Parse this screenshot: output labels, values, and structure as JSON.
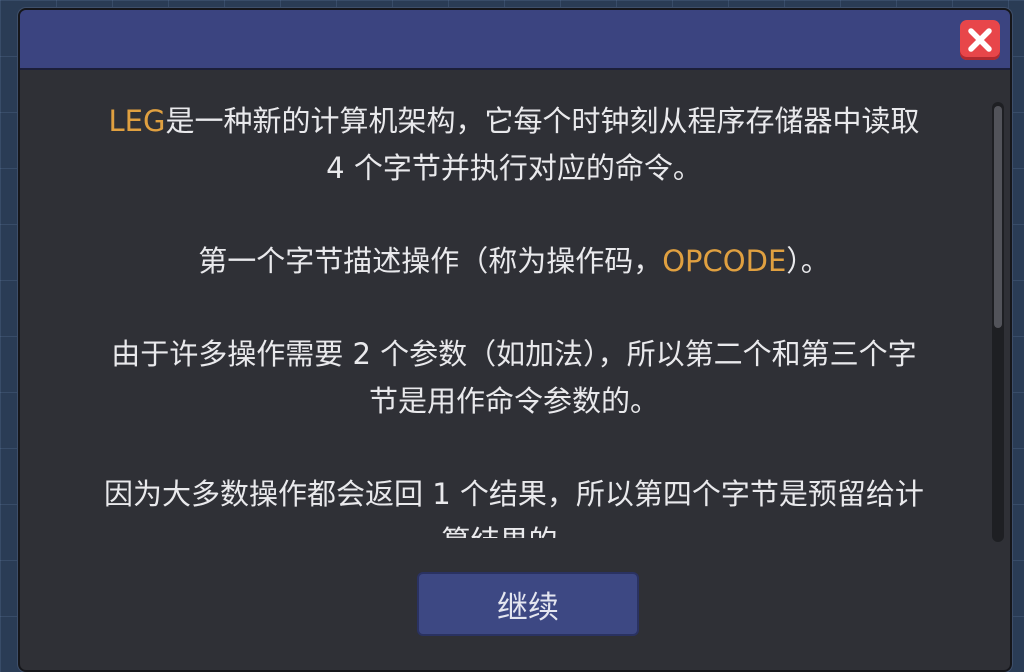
{
  "dialog": {
    "close_icon": "close-icon",
    "paragraphs": [
      {
        "lines": [
          [
            {
              "text": "LEG",
              "highlight": true
            },
            {
              "text": "是一种新的计算机架构，它每个时钟刻从程序存储器中读取",
              "highlight": false
            }
          ],
          [
            {
              "text": "4 个字节并执行对应的命令。",
              "highlight": false
            }
          ]
        ]
      },
      {
        "lines": [
          [
            {
              "text": "第一个字节描述操作（称为操作码，",
              "highlight": false
            },
            {
              "text": "OPCODE",
              "highlight": true
            },
            {
              "text": "）。",
              "highlight": false
            }
          ]
        ]
      },
      {
        "lines": [
          [
            {
              "text": "由于许多操作需要 2 个参数（如加法），所以第二个和第三个字",
              "highlight": false
            }
          ],
          [
            {
              "text": "节是用作命令参数的。",
              "highlight": false
            }
          ]
        ]
      },
      {
        "lines": [
          [
            {
              "text": "因为大多数操作都会返回 1 个结果，所以第四个字节是预留给计",
              "highlight": false
            }
          ],
          [
            {
              "text": "算结果的。",
              "highlight": false
            }
          ]
        ]
      }
    ],
    "continue_label": "继续",
    "colors": {
      "highlight": "#e0a040",
      "text": "#e9e9ec",
      "titlebar": "#3b4480",
      "close_button": "#e8464a"
    }
  }
}
